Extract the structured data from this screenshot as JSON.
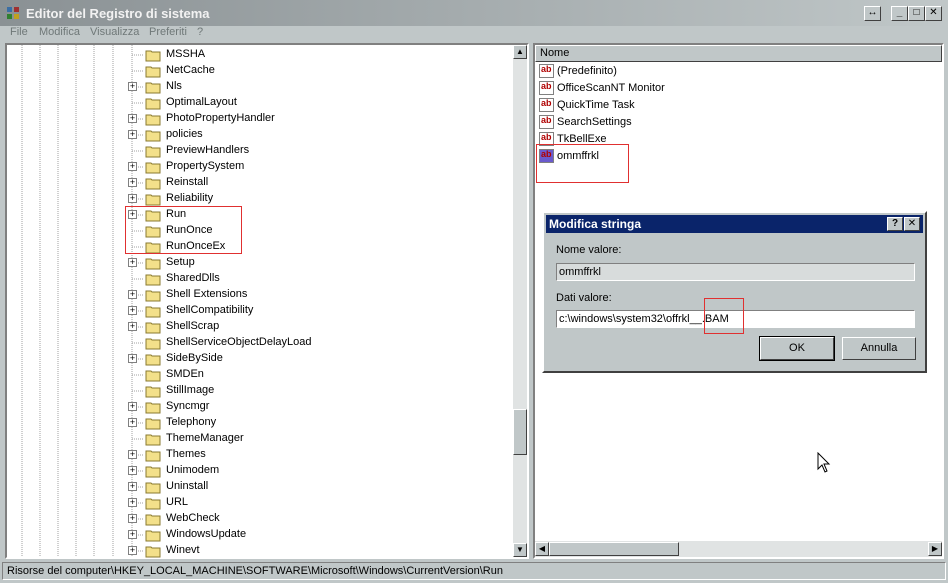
{
  "window": {
    "title": "Editor del Registro di sistema"
  },
  "menu": [
    "File",
    "Modifica",
    "Visualizza",
    "Preferiti",
    "?"
  ],
  "tree": {
    "items": [
      {
        "label": "MSSHA",
        "expandable": false
      },
      {
        "label": "NetCache",
        "expandable": false
      },
      {
        "label": "Nls",
        "expandable": true
      },
      {
        "label": "OptimalLayout",
        "expandable": false
      },
      {
        "label": "PhotoPropertyHandler",
        "expandable": true
      },
      {
        "label": "policies",
        "expandable": true
      },
      {
        "label": "PreviewHandlers",
        "expandable": false
      },
      {
        "label": "PropertySystem",
        "expandable": true
      },
      {
        "label": "Reinstall",
        "expandable": true
      },
      {
        "label": "Reliability",
        "expandable": true
      },
      {
        "label": "Run",
        "expandable": true
      },
      {
        "label": "RunOnce",
        "expandable": false
      },
      {
        "label": "RunOnceEx",
        "expandable": false
      },
      {
        "label": "Setup",
        "expandable": true
      },
      {
        "label": "SharedDlls",
        "expandable": false
      },
      {
        "label": "Shell Extensions",
        "expandable": true
      },
      {
        "label": "ShellCompatibility",
        "expandable": true
      },
      {
        "label": "ShellScrap",
        "expandable": true
      },
      {
        "label": "ShellServiceObjectDelayLoad",
        "expandable": false
      },
      {
        "label": "SideBySide",
        "expandable": true
      },
      {
        "label": "SMDEn",
        "expandable": false
      },
      {
        "label": "StillImage",
        "expandable": false
      },
      {
        "label": "Syncmgr",
        "expandable": true
      },
      {
        "label": "Telephony",
        "expandable": true
      },
      {
        "label": "ThemeManager",
        "expandable": false
      },
      {
        "label": "Themes",
        "expandable": true
      },
      {
        "label": "Unimodem",
        "expandable": true
      },
      {
        "label": "Uninstall",
        "expandable": true
      },
      {
        "label": "URL",
        "expandable": true
      },
      {
        "label": "WebCheck",
        "expandable": true
      },
      {
        "label": "WindowsUpdate",
        "expandable": true
      },
      {
        "label": "Winevt",
        "expandable": true
      }
    ]
  },
  "list": {
    "column": "Nome",
    "values": [
      "(Predefinito)",
      "OfficeScanNT Monitor",
      "QuickTime Task",
      "SearchSettings",
      "TkBellExe",
      "ommffrkl"
    ]
  },
  "dialog": {
    "title": "Modifica stringa",
    "help": "?",
    "close": "✕",
    "name_label": "Nome valore:",
    "name_value": "ommffrkl",
    "data_label": "Dati valore:",
    "data_value": "c:\\windows\\system32\\offrkl__.BAM",
    "ok": "OK",
    "cancel": "Annulla"
  },
  "status": "Risorse del computer\\HKEY_LOCAL_MACHINE\\SOFTWARE\\Microsoft\\Windows\\CurrentVersion\\Run",
  "colors": {
    "title_active": "#0a246a",
    "highlight_box": "#e03030",
    "face": "#c0c7c8"
  }
}
